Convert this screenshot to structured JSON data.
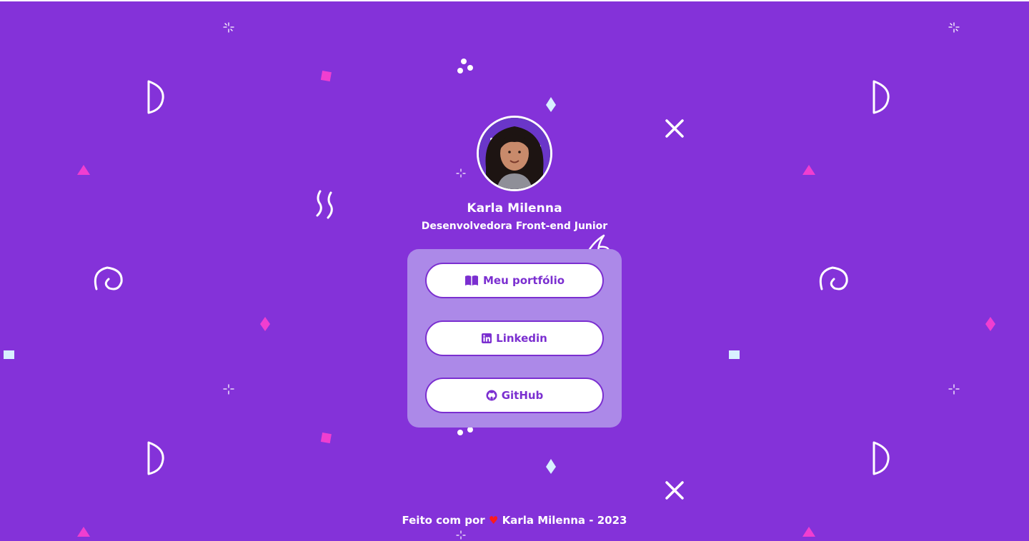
{
  "profile": {
    "name": "Karla Milenna",
    "role": "Desenvolvedora Front-end Junior"
  },
  "links": [
    {
      "label": "Meu portfólio",
      "icon": "book-icon"
    },
    {
      "label": "Linkedin",
      "icon": "linkedin-icon"
    },
    {
      "label": "GitHub",
      "icon": "github-icon"
    }
  ],
  "footer": {
    "prefix": "Feito com por",
    "heart": "♥",
    "suffix": "Karla Milenna - 2023"
  },
  "colors": {
    "background": "#8432d9",
    "card": "#ac89e8",
    "accent": "#7b2fd0",
    "pink": "#f03ed0",
    "light": "#d8f0ff",
    "heart": "#ff1a1a"
  }
}
